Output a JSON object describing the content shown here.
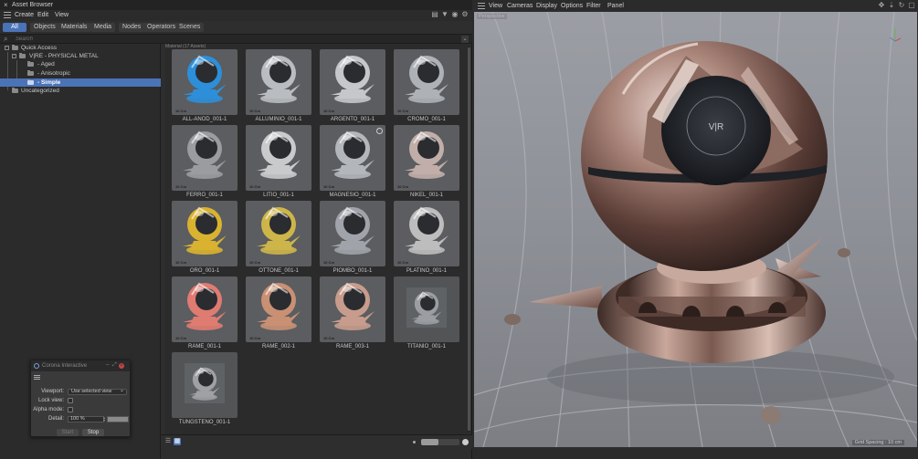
{
  "asset_browser": {
    "title": "Asset Browser",
    "menu": [
      "Create",
      "Edit",
      "View"
    ],
    "tabs": [
      "All",
      "Objects",
      "Materials",
      "Media",
      "Nodes",
      "Operators",
      "Scenes"
    ],
    "active_tab": "All",
    "search_placeholder": "Search",
    "grid_header": "Material (17 Assets)",
    "tree": {
      "quick_access": "Quick Access",
      "group": "V|RE - PHYSICAL METAL",
      "aged": "- Aged",
      "anisotropic": "- Anisotropic",
      "simple": "- Simple",
      "uncategorized": "Uncategorized"
    },
    "assets": [
      {
        "name": "ALL-ANOD_001-1",
        "tint": "#2d8fd9"
      },
      {
        "name": "ALLUMINIO_001-1",
        "tint": "#b9bcc0"
      },
      {
        "name": "ARGENTO_001-1",
        "tint": "#c5c7ca"
      },
      {
        "name": "CROMO_001-1",
        "tint": "#aeb2b7"
      },
      {
        "name": "FERRO_001-1",
        "tint": "#9a9ca0"
      },
      {
        "name": "LITIO_001-1",
        "tint": "#c8cacb"
      },
      {
        "name": "MAGNESIO_001-1",
        "tint": "#b3b6ba"
      },
      {
        "name": "NIKEL_001-1",
        "tint": "#c1aea9"
      },
      {
        "name": "ORO_001-1",
        "tint": "#d9b230"
      },
      {
        "name": "OTTONE_001-1",
        "tint": "#cdb54a"
      },
      {
        "name": "PIOMBO_001-1",
        "tint": "#a0a4aa"
      },
      {
        "name": "PLATINO_001-1",
        "tint": "#bdbdbd"
      },
      {
        "name": "RAME_001-1",
        "tint": "#e07b72"
      },
      {
        "name": "RAME_002-1",
        "tint": "#c99074"
      },
      {
        "name": "RAME_003-1",
        "tint": "#c79c8c"
      },
      {
        "name": "TITANIO_001-1",
        "tint": "#9a9ea3"
      },
      {
        "name": "TUNGSTENO_001-1",
        "tint": "#9fa1a4"
      }
    ],
    "thumb_tag": "10 Cm",
    "thumbnail_zoom_percent": 45
  },
  "dialog": {
    "title": "Corona Interactive",
    "viewport_label": "Viewport:",
    "viewport_value": "Use selected view",
    "lock_view_label": "Lock view:",
    "alpha_mode_label": "Alpha mode:",
    "detail_label": "Detail:",
    "detail_value": "100 %",
    "start": "Start",
    "stop": "Stop"
  },
  "viewport": {
    "menu": [
      "View",
      "Cameras",
      "Display",
      "Options",
      "Filter",
      "Panel"
    ],
    "camera_label": "Perspective",
    "grid_spacing": "Grid Spacing : 10 cm",
    "logo_text": "V|R"
  },
  "colors": {
    "accent": "#4a73b8",
    "panel_bg": "#2e2e2e",
    "floor": "#8f9197"
  }
}
